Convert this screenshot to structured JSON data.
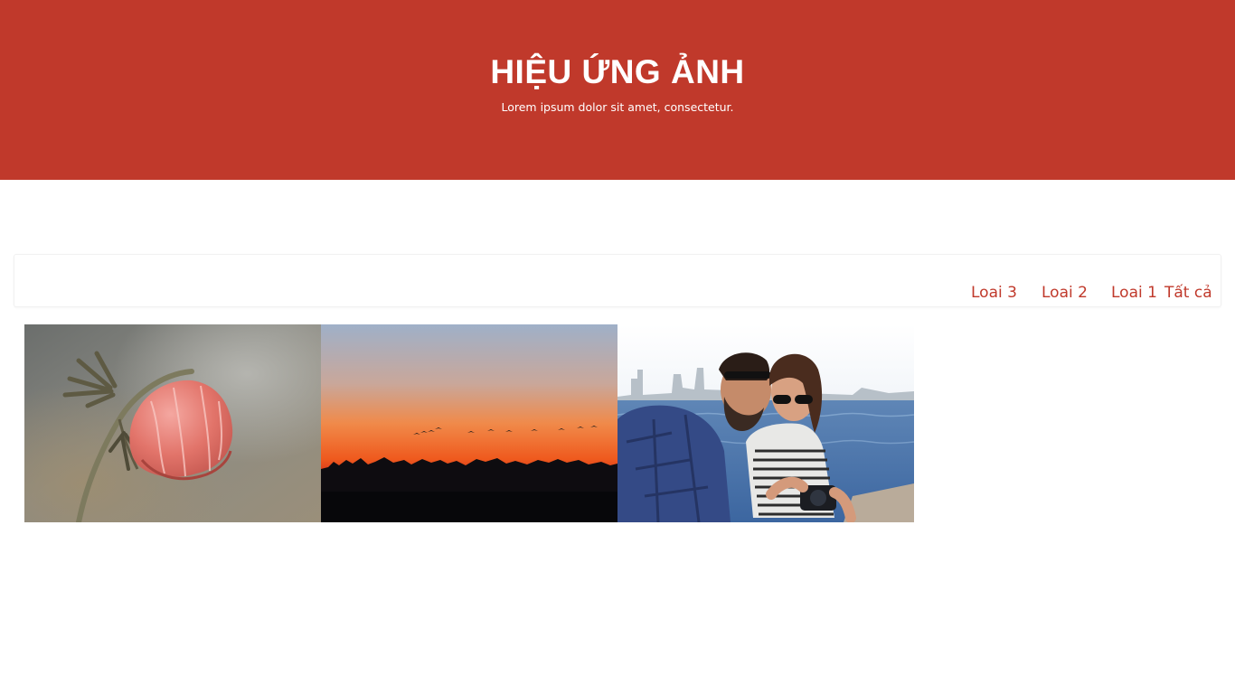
{
  "hero": {
    "title": "HIỆU ỨNG ẢNH",
    "subtitle": "Lorem ipsum dolor sit amet, consectetur."
  },
  "filters": {
    "items": [
      {
        "label": "Loai 3"
      },
      {
        "label": "Loai 2"
      },
      {
        "label": "Loai 1"
      },
      {
        "label": "Tất cả"
      }
    ]
  },
  "gallery": {
    "photos": [
      {
        "subject": "frosted-flower-photo"
      },
      {
        "subject": "sunset-birds-photo"
      },
      {
        "subject": "couple-camera-photo"
      }
    ]
  },
  "colors": {
    "brand": "#c0392b",
    "background": "#ffffff"
  }
}
